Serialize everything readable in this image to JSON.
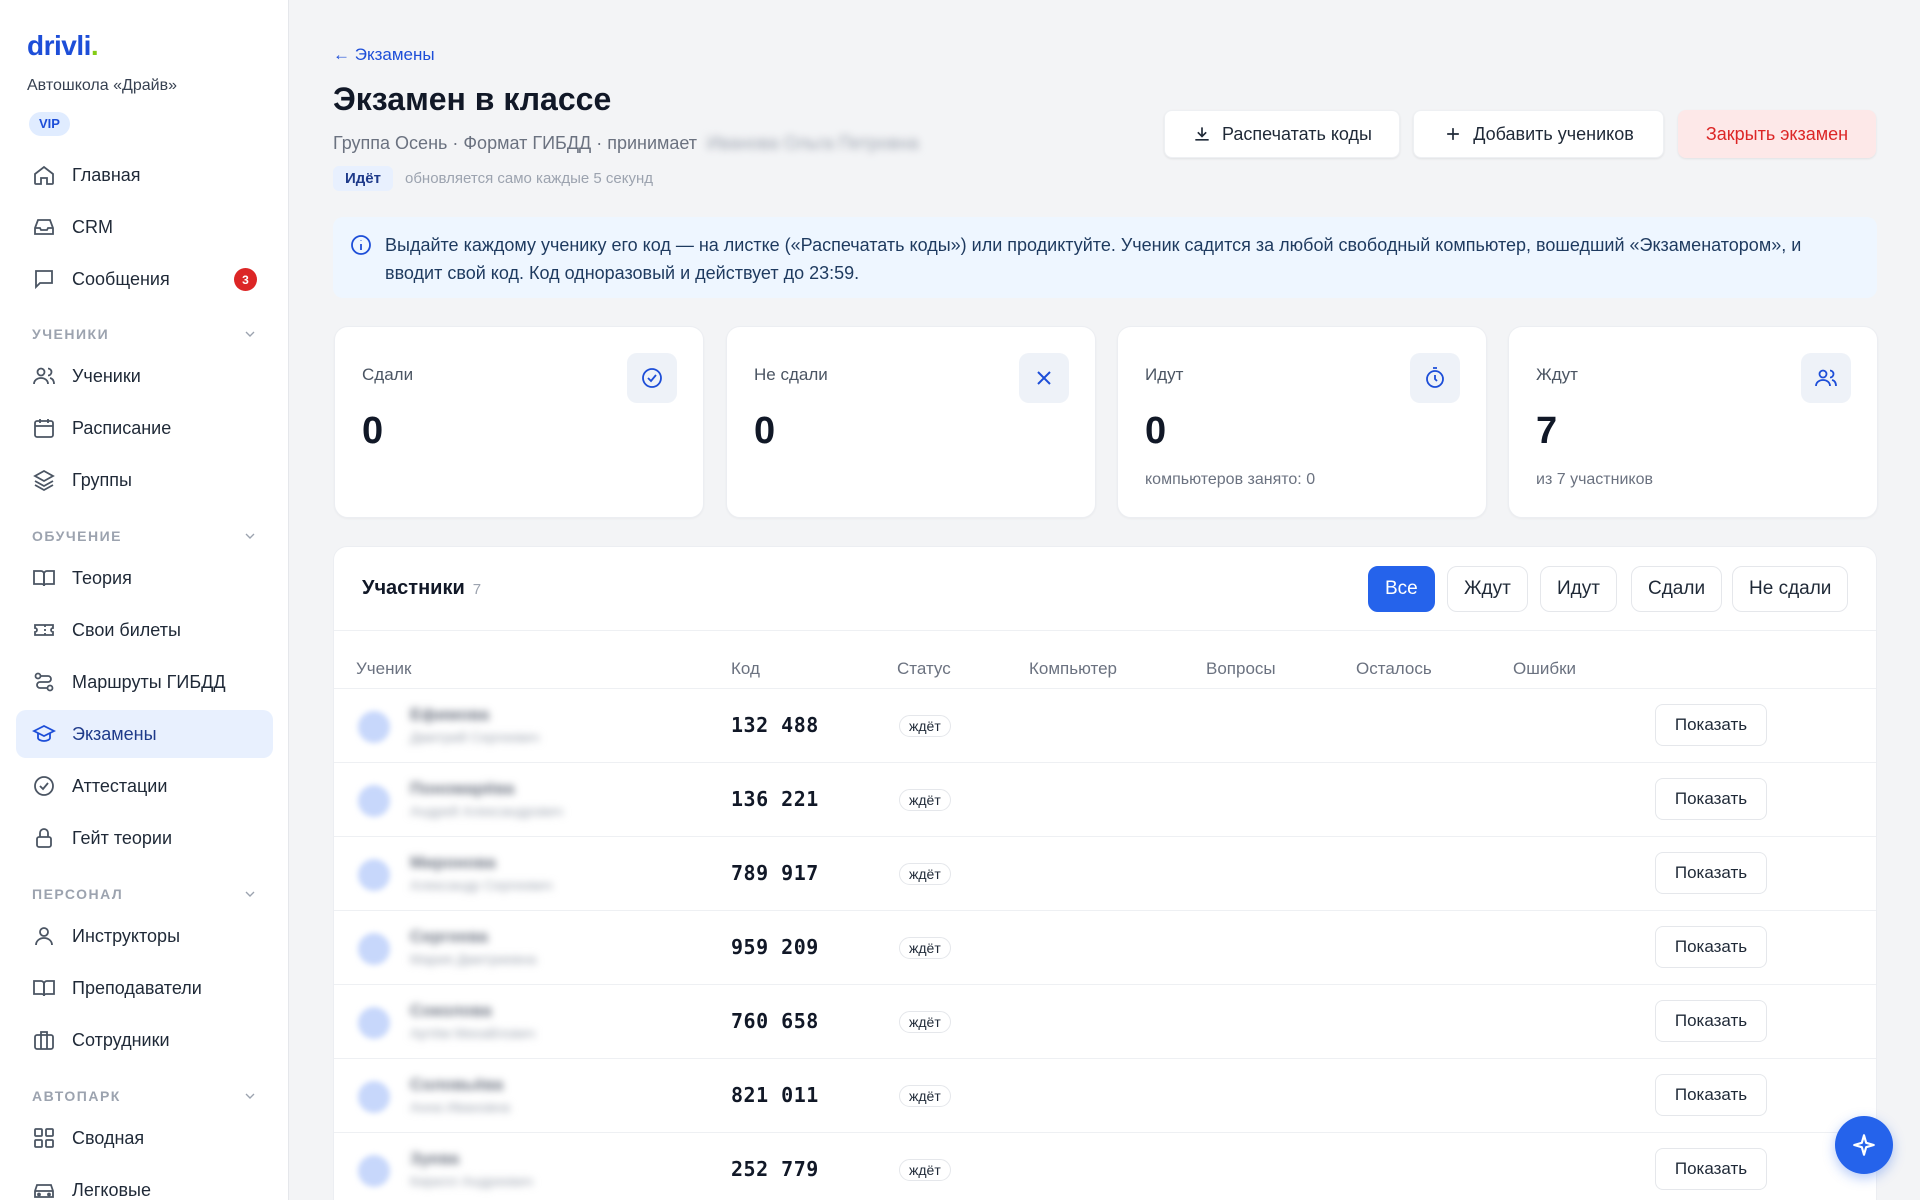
{
  "sidebar": {
    "logo": "drivli",
    "logo_dot": ".",
    "school": "Автошкола «Драйв»",
    "plan_badge": "VIP",
    "top_items": [
      {
        "label": "Главная",
        "icon": "home-icon"
      },
      {
        "label": "CRM",
        "icon": "inbox-icon"
      },
      {
        "label": "Сообщения",
        "icon": "message-icon",
        "badge": "3"
      }
    ],
    "sections": [
      {
        "title": "УЧЕНИКИ",
        "items": [
          {
            "label": "Ученики",
            "icon": "users-icon"
          },
          {
            "label": "Расписание",
            "icon": "calendar-icon"
          },
          {
            "label": "Группы",
            "icon": "layers-icon"
          }
        ]
      },
      {
        "title": "ОБУЧЕНИЕ",
        "items": [
          {
            "label": "Теория",
            "icon": "book-icon"
          },
          {
            "label": "Свои билеты",
            "icon": "ticket-icon"
          },
          {
            "label": "Маршруты ГИБДД",
            "icon": "route-icon"
          },
          {
            "label": "Экзамены",
            "icon": "graduation-cap-icon",
            "active": true
          },
          {
            "label": "Аттестации",
            "icon": "check-circle-icon"
          },
          {
            "label": "Гейт теории",
            "icon": "lock-icon"
          }
        ]
      },
      {
        "title": "ПЕРСОНАЛ",
        "items": [
          {
            "label": "Инструкторы",
            "icon": "user-icon"
          },
          {
            "label": "Преподаватели",
            "icon": "book-open-icon"
          },
          {
            "label": "Сотрудники",
            "icon": "briefcase-icon"
          }
        ]
      },
      {
        "title": "АВТОПАРК",
        "items": [
          {
            "label": "Сводная",
            "icon": "grid-icon"
          },
          {
            "label": "Легковые",
            "icon": "car-icon"
          }
        ]
      }
    ]
  },
  "header": {
    "back_label": "← Экзамены",
    "title": "Экзамен в классе",
    "subtitle": "Группа Осень · Формат ГИБДД · принимает",
    "examiner": "Иванова Ольга Петровна",
    "status": "Идёт",
    "status_note": "обновляется само каждые 5 секунд",
    "actions": {
      "print": "Распечатать коды",
      "add": "Добавить учеников",
      "close": "Закрыть экзамен"
    }
  },
  "info": {
    "text": "Выдайте каждому ученику его код — на листке («Распечатать коды») или продиктуйте. Ученик садится за любой свободный компьютер, вошедший «Экзаменатором», и вводит свой код. Код одноразовый и действует до 23:59."
  },
  "stats": [
    {
      "label": "Сдали",
      "value": "0",
      "note": "",
      "icon": "check-circle-icon"
    },
    {
      "label": "Не сдали",
      "value": "0",
      "note": "",
      "icon": "x-icon"
    },
    {
      "label": "Идут",
      "value": "0",
      "note": "компьютеров занято: 0",
      "icon": "timer-icon"
    },
    {
      "label": "Ждут",
      "value": "7",
      "note": "из 7 участников",
      "icon": "users-icon"
    }
  ],
  "participants": {
    "title": "Участники",
    "count": "7",
    "filters": [
      "Все",
      "Ждут",
      "Идут",
      "Сдали",
      "Не сдали"
    ],
    "active_filter": 0,
    "columns": [
      "Ученик",
      "Код",
      "Статус",
      "Компьютер",
      "Вопросы",
      "Осталось",
      "Ошибки"
    ],
    "show_label": "Показать",
    "rows": [
      {
        "name": "Ефимова",
        "sub": "Дмитрий Сергеевич",
        "initials": "ЕД",
        "code": "132 488",
        "status": "ждёт"
      },
      {
        "name": "Пономарёва",
        "sub": "Андрей Александрович",
        "initials": "ПА",
        "code": "136 221",
        "status": "ждёт"
      },
      {
        "name": "Миронова",
        "sub": "Александр Сергеевич",
        "initials": "МА",
        "code": "789 917",
        "status": "ждёт"
      },
      {
        "name": "Сергеева",
        "sub": "Мария Дмитриевна",
        "initials": "СМ",
        "code": "959 209",
        "status": "ждёт"
      },
      {
        "name": "Соколова",
        "sub": "Артём Михайлович",
        "initials": "СА",
        "code": "760 658",
        "status": "ждёт"
      },
      {
        "name": "Соловьёва",
        "sub": "Анна Ивановна",
        "initials": "СА",
        "code": "821 011",
        "status": "ждёт"
      },
      {
        "name": "Зуева",
        "sub": "Кирилл Андреевич",
        "initials": "ЗК",
        "code": "252 779",
        "status": "ждёт"
      }
    ]
  },
  "colors": {
    "primary": "#2563eb",
    "danger": "#dc2626",
    "brand_accent": "#84cc16"
  },
  "fab_icon": "sparkle-icon"
}
